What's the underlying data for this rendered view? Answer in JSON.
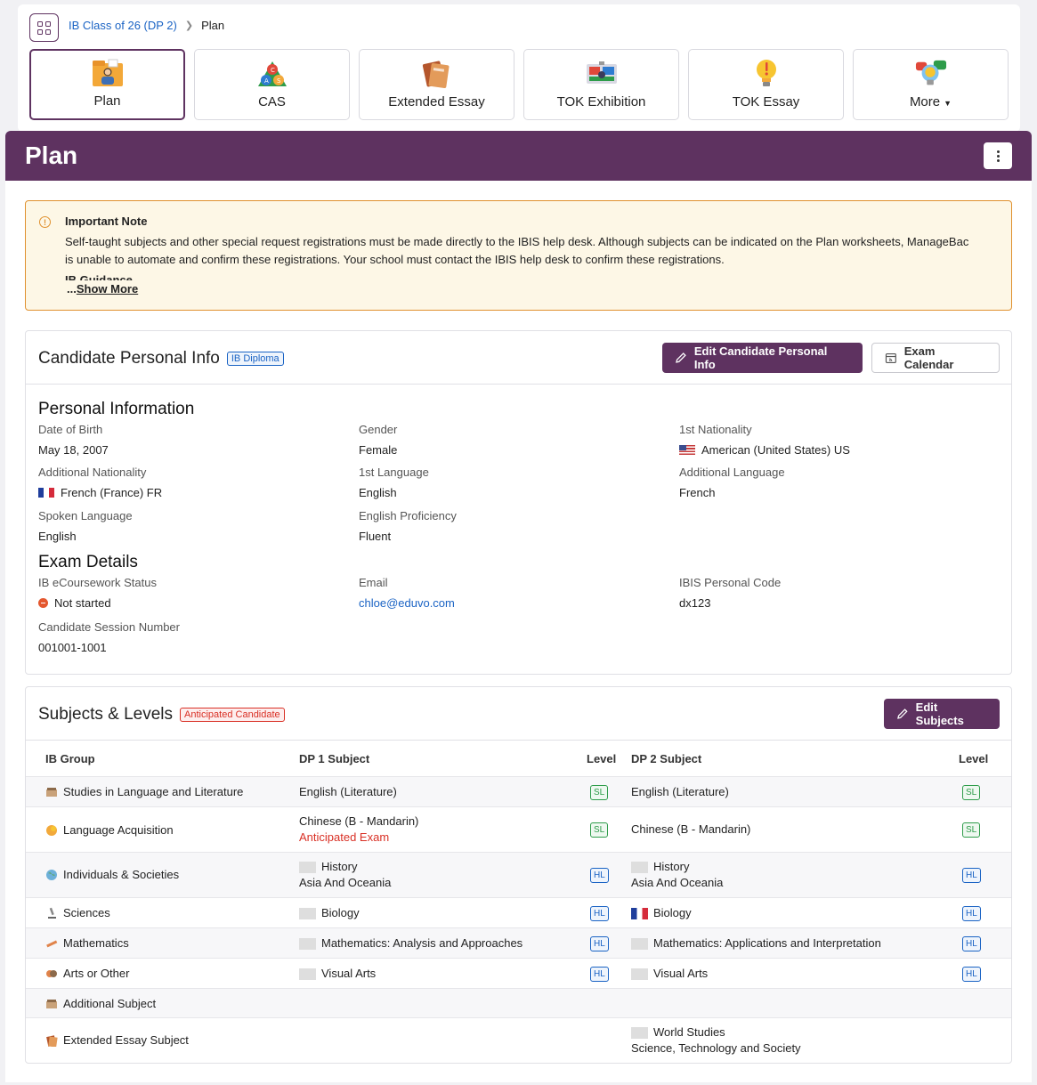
{
  "breadcrumb": {
    "parent": "IB Class of 26 (DP 2)",
    "current": "Plan"
  },
  "tabs": [
    {
      "label": "Plan",
      "icon": "folder-person-icon",
      "active": true
    },
    {
      "label": "CAS",
      "icon": "cas-triangle-icon"
    },
    {
      "label": "Extended Essay",
      "icon": "books-icon"
    },
    {
      "label": "TOK Exhibition",
      "icon": "exhibition-board-icon"
    },
    {
      "label": "TOK Essay",
      "icon": "lightbulb-icon"
    },
    {
      "label": "More",
      "icon": "lightbulb-chat-icon"
    }
  ],
  "header": {
    "title": "Plan"
  },
  "note": {
    "title": "Important Note",
    "text": "Self-taught subjects and other special request registrations must be made directly to the IBIS help desk. Although subjects can be indicated on the Plan worksheets, ManageBac is unable to automate and confirm these registrations. Your school must contact the IBIS help desk to confirm these registrations.",
    "guidance": "IB Guidance",
    "more_prefix": "...",
    "more_label": "Show More"
  },
  "candidate": {
    "title": "Candidate Personal Info",
    "badge": "IB Diploma",
    "edit_label": "Edit Candidate Personal Info",
    "calendar_label": "Exam Calendar",
    "personal_title": "Personal Information",
    "dob_label": "Date of Birth",
    "dob": "May 18, 2007",
    "gender_label": "Gender",
    "gender": "Female",
    "nat1_label": "1st Nationality",
    "nat1": "American (United States) US",
    "addnat_label": "Additional Nationality",
    "addnat": "French (France) FR",
    "lang1_label": "1st Language",
    "lang1": "English",
    "addlang_label": "Additional Language",
    "addlang": "French",
    "spoken_label": "Spoken Language",
    "spoken": "English",
    "prof_label": "English Proficiency",
    "prof": "Fluent",
    "exam_title": "Exam Details",
    "ecw_label": "IB eCoursework Status",
    "ecw": "Not started",
    "email_label": "Email",
    "email": "chloe@eduvo.com",
    "ibis_label": "IBIS Personal Code",
    "ibis": "dx123",
    "session_label": "Candidate Session Number",
    "session": "001001-1001"
  },
  "subjects": {
    "title": "Subjects & Levels",
    "badge": "Anticipated Candidate",
    "edit_label": "Edit Subjects",
    "headers": {
      "group": "IB Group",
      "dp1": "DP 1 Subject",
      "level1": "Level",
      "dp2": "DP 2 Subject",
      "level2": "Level"
    },
    "rows": [
      {
        "group": "Studies in Language and Literature",
        "dp1": "English (Literature)",
        "dp1_sub": "",
        "lvl1": "SL",
        "dp2": "English (Literature)",
        "dp2_sub": "",
        "lvl2": "SL"
      },
      {
        "group": "Language Acquisition",
        "dp1": "Chinese (B - Mandarin)",
        "dp1_sub": "Anticipated Exam",
        "lvl1": "SL",
        "dp2": "Chinese (B - Mandarin)",
        "dp2_sub": "",
        "lvl2": "SL"
      },
      {
        "group": "Individuals & Societies",
        "dp1": "History",
        "dp1_sub": "Asia And Oceania",
        "lvl1": "HL",
        "dp2": "History",
        "dp2_sub": "Asia And Oceania",
        "lvl2": "HL"
      },
      {
        "group": "Sciences",
        "dp1": "Biology",
        "dp1_sub": "",
        "lvl1": "HL",
        "dp2": "Biology",
        "dp2_sub": "",
        "lvl2": "HL"
      },
      {
        "group": "Mathematics",
        "dp1": "Mathematics: Analysis and Approaches",
        "dp1_sub": "",
        "lvl1": "HL",
        "dp2": "Mathematics: Applications and Interpretation",
        "dp2_sub": "",
        "lvl2": "HL"
      },
      {
        "group": "Arts or Other",
        "dp1": "Visual Arts",
        "dp1_sub": "",
        "lvl1": "HL",
        "dp2": "Visual Arts",
        "dp2_sub": "",
        "lvl2": "HL"
      },
      {
        "group": "Additional Subject",
        "dp1": "",
        "dp1_sub": "",
        "lvl1": "",
        "dp2": "",
        "dp2_sub": "",
        "lvl2": ""
      },
      {
        "group": "Extended Essay Subject",
        "dp1": "",
        "dp1_sub": "",
        "lvl1": "",
        "dp2": "World Studies",
        "dp2_sub": "Science, Technology and Society",
        "lvl2": ""
      }
    ]
  }
}
